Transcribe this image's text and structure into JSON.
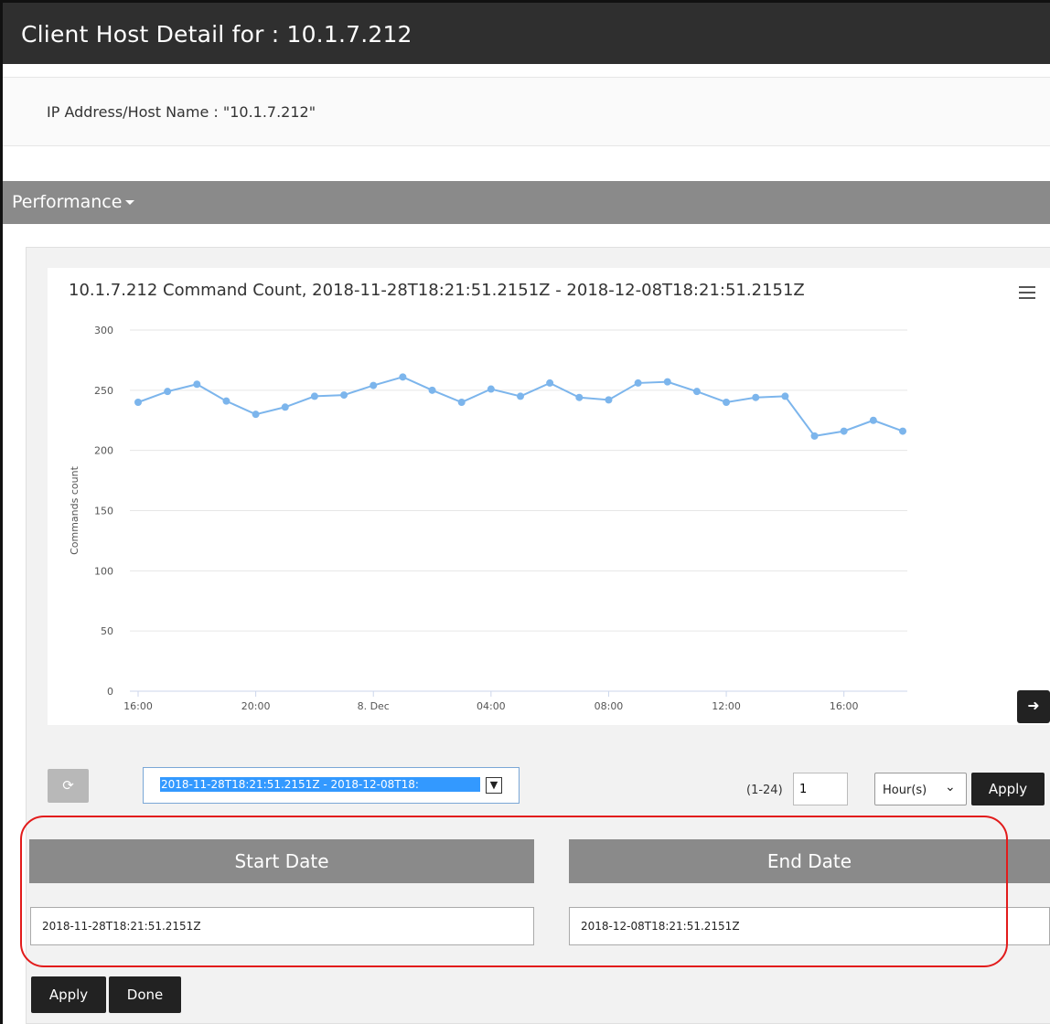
{
  "header": {
    "title": "Client Host Detail for : 10.1.7.212"
  },
  "host": {
    "label": "IP Address/Host Name : \"10.1.7.212\""
  },
  "section": {
    "label": "Performance"
  },
  "chart_data": {
    "type": "line",
    "title": "10.1.7.212 Command Count, 2018-11-28T18:21:51.2151Z - 2018-12-08T18:21:51.2151Z",
    "xlabel": "",
    "ylabel": "Commands count",
    "ylim": [
      0,
      300
    ],
    "yticks": [
      "0",
      "50",
      "100",
      "150",
      "200",
      "250",
      "300"
    ],
    "xticks": [
      "16:00",
      "20:00",
      "8. Dec",
      "04:00",
      "08:00",
      "12:00",
      "16:00"
    ],
    "grid": true,
    "color": "#7cb5ec",
    "series": [
      {
        "values": [
          240,
          249,
          255,
          241,
          230,
          236,
          245,
          246,
          254,
          261,
          250,
          240,
          251,
          245,
          256,
          244,
          242,
          256,
          257,
          249,
          240,
          244,
          245,
          212,
          216,
          225,
          216
        ]
      }
    ]
  },
  "controls": {
    "range_value": "2018-11-28T18:21:51.2151Z - 2018-12-08T18:",
    "range_label": "(1-24)",
    "range_input": "1",
    "unit": "Hour(s)",
    "apply": "Apply"
  },
  "dates": {
    "start_label": "Start Date",
    "end_label": "End Date",
    "start_value": "2018-11-28T18:21:51.2151Z",
    "end_value": "2018-12-08T18:21:51.2151Z"
  },
  "footer": {
    "apply": "Apply",
    "done": "Done"
  },
  "icons": {
    "refresh": "refresh-icon",
    "arrow": "arrow-right-icon",
    "menu": "hamburger-menu-icon"
  }
}
